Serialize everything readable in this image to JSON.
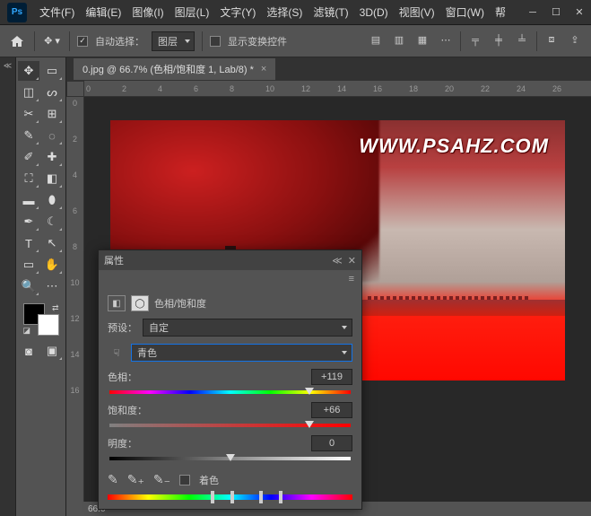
{
  "menu": [
    "文件(F)",
    "编辑(E)",
    "图像(I)",
    "图层(L)",
    "文字(Y)",
    "选择(S)",
    "滤镜(T)",
    "3D(D)",
    "视图(V)",
    "窗口(W)",
    "帮"
  ],
  "options": {
    "auto_select": "自动选择：",
    "target": "图层",
    "show_transform": "显示变换控件"
  },
  "doc": {
    "tab": "0.jpg @ 66.7% (色相/饱和度 1, Lab/8) *",
    "zoom": "66.6",
    "watermark": "WWW.PSAHZ.COM"
  },
  "ruler_h": [
    "0",
    "2",
    "4",
    "6",
    "8",
    "10",
    "12",
    "14",
    "16",
    "18",
    "20",
    "22",
    "24",
    "26"
  ],
  "ruler_v": [
    "0",
    "2",
    "4",
    "6",
    "8",
    "10",
    "12",
    "14",
    "16"
  ],
  "panel": {
    "title": "属性",
    "adj_name": "色相/饱和度",
    "preset_lbl": "预设：",
    "preset_val": "自定",
    "channel": "青色",
    "hue_lbl": "色相：",
    "hue_val": "+119",
    "sat_lbl": "饱和度：",
    "sat_val": "+66",
    "lit_lbl": "明度：",
    "lit_val": "0",
    "colorize": "着色"
  }
}
